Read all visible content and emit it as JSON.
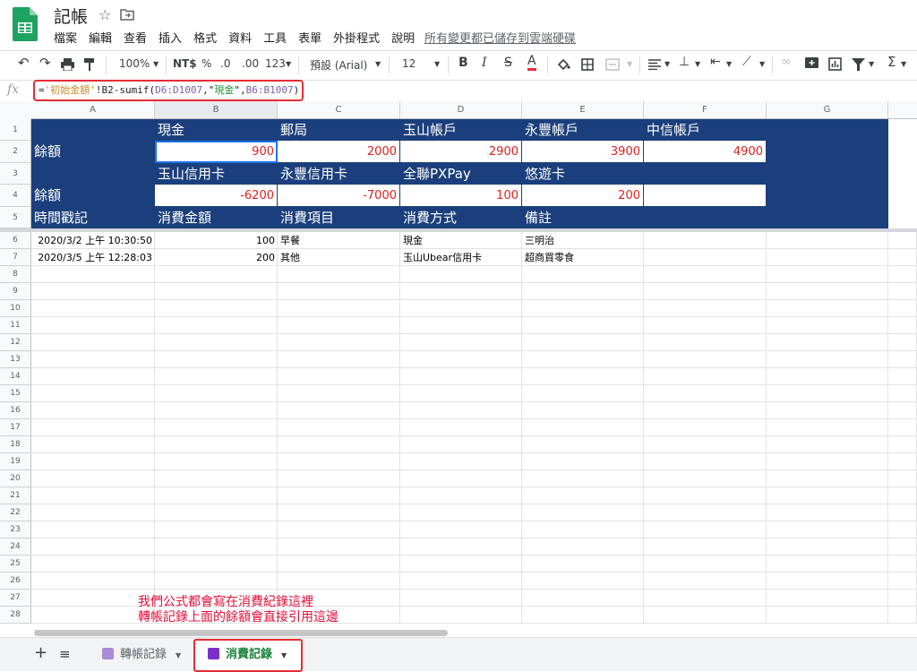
{
  "app": {
    "title": "記帳",
    "menu": [
      "檔案",
      "編輯",
      "查看",
      "插入",
      "格式",
      "資料",
      "工具",
      "表單",
      "外掛程式",
      "說明"
    ],
    "save_status": "所有變更都已儲存到雲端硬碟"
  },
  "toolbar": {
    "zoom": "100%",
    "currency": "NT$",
    "percent": "%",
    "dec_less": ".0",
    "dec_more": ".00",
    "number_format": "123",
    "font": "預設 (Arial)",
    "font_size": "12",
    "bold": "B",
    "italic": "I",
    "strike": "S",
    "text_color": "A",
    "sigma": "Σ"
  },
  "formula_bar": {
    "fx": "fx",
    "eq": "=",
    "sheet_ref": "'初始金額'",
    "p1": "!B2-sumif(",
    "range1": "D6:D1007",
    "p2": ",\"",
    "crit": "現金",
    "p3": "\",",
    "range2": "B6:B1007",
    "p4": ")"
  },
  "grid": {
    "columns": [
      "A",
      "B",
      "C",
      "D",
      "E",
      "F",
      "G"
    ],
    "rows": [
      "1",
      "2",
      "3",
      "4",
      "5",
      "6",
      "7",
      "8",
      "9",
      "10",
      "11",
      "12",
      "13",
      "14",
      "15",
      "16",
      "17",
      "18",
      "19",
      "20",
      "21",
      "22",
      "23",
      "24",
      "25",
      "26",
      "27",
      "28"
    ],
    "header_rows": {
      "r1": [
        "",
        "現金",
        "郵局",
        "玉山帳戶",
        "永豐帳戶",
        "中信帳戶"
      ],
      "r2_label": "餘額",
      "r2_values": [
        "900",
        "2000",
        "2900",
        "3900",
        "4900"
      ],
      "r3": [
        "",
        "玉山信用卡",
        "永豐信用卡",
        "全聯PXPay",
        "悠遊卡",
        ""
      ],
      "r4_label": "餘額",
      "r4_values": [
        "-6200",
        "-7000",
        "100",
        "200",
        ""
      ],
      "r5": [
        "時間戳記",
        "消費金額",
        "消費項目",
        "消費方式",
        "備註",
        ""
      ]
    },
    "data_rows": [
      [
        "2020/3/2 上午 10:30:50",
        "100",
        "早餐",
        "現金",
        "三明治"
      ],
      [
        "2020/3/5 上午 12:28:03",
        "200",
        "其他",
        "玉山Ubear信用卡",
        "超商買零食"
      ]
    ]
  },
  "annotation": {
    "line1": "我們公式都會寫在消費紀錄這裡",
    "line2": "轉帳記錄上面的餘額會直接引用這邊"
  },
  "tabs": [
    {
      "label": "轉帳記錄"
    },
    {
      "label": "消費記錄"
    }
  ],
  "colors": {
    "header_blue": "#1b3f7c",
    "negative_red": "#e02020",
    "highlight_red": "#e52d35",
    "sheet_green": "#188038"
  }
}
